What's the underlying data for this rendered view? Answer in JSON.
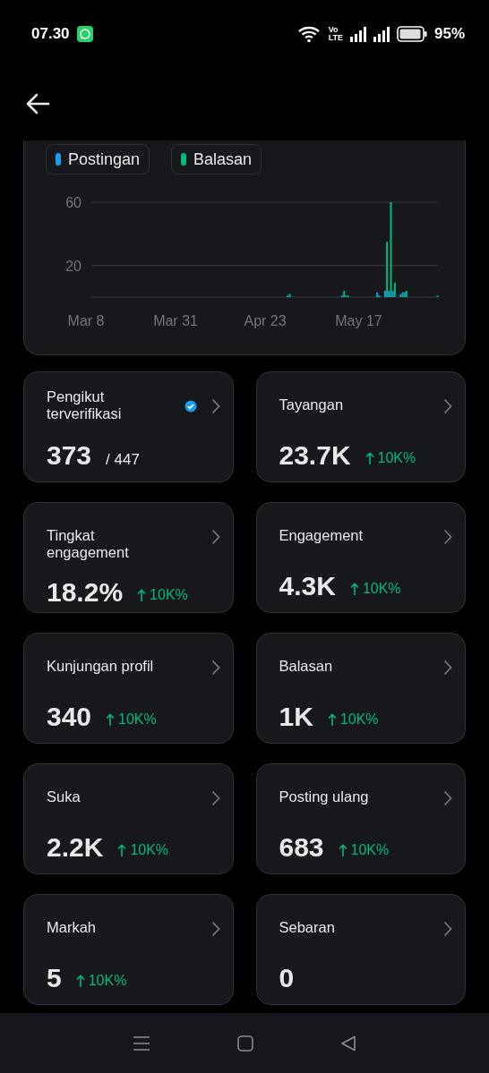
{
  "status_bar": {
    "time": "07.30",
    "network_label_top": "Vo",
    "network_label_bottom": "LTE",
    "battery": "95%"
  },
  "chart": {
    "chart_data": {
      "type": "bar",
      "categories": [
        "Mar 8",
        null,
        null,
        null,
        null,
        null,
        null,
        null,
        null,
        null,
        null,
        null,
        null,
        null,
        null,
        null,
        null,
        null,
        null,
        null,
        null,
        null,
        null,
        "Mar 31",
        null,
        null,
        null,
        null,
        null,
        null,
        null,
        null,
        null,
        null,
        null,
        null,
        null,
        null,
        null,
        null,
        null,
        null,
        null,
        null,
        null,
        null,
        "Apr 23",
        null,
        null,
        null,
        null,
        null,
        null,
        null,
        null,
        null,
        null,
        null,
        null,
        null,
        null,
        null,
        null,
        null,
        null,
        null,
        null,
        null,
        null,
        null,
        "May 17",
        null,
        null,
        null,
        null,
        null,
        null,
        null,
        null,
        null,
        null,
        null,
        null,
        null,
        null,
        null,
        null,
        null,
        null,
        null,
        null
      ],
      "series": [
        {
          "name": "Postingan",
          "color": "#1d9bf0",
          "values": [
            0,
            0,
            0,
            0,
            0,
            0,
            0,
            0,
            0,
            0,
            0,
            0,
            0,
            0,
            0,
            0,
            0,
            0,
            0,
            0,
            0,
            0,
            0,
            0,
            0,
            0,
            0,
            0,
            0,
            0,
            0,
            0,
            0,
            0,
            0,
            0,
            0,
            0,
            0,
            0,
            0,
            0,
            0,
            0,
            0,
            0,
            0,
            0,
            0,
            0,
            0,
            0,
            1,
            0,
            0,
            0,
            0,
            0,
            0,
            0,
            0,
            0,
            0,
            0,
            0,
            0,
            1,
            1,
            0,
            0,
            0,
            0,
            0,
            0,
            0,
            3,
            0,
            4,
            4,
            4,
            0,
            2,
            3,
            0,
            0,
            0,
            0,
            0,
            0,
            0,
            0
          ]
        },
        {
          "name": "Balasan",
          "color": "#00ba7c",
          "values": [
            0,
            0,
            0,
            0,
            0,
            0,
            0,
            0,
            0,
            0,
            0,
            0,
            0,
            0,
            0,
            0,
            0,
            0,
            0,
            0,
            0,
            0,
            0,
            0,
            0,
            0,
            0,
            0,
            0,
            0,
            0,
            0,
            0,
            0,
            0,
            0,
            0,
            0,
            0,
            0,
            0,
            0,
            0,
            0,
            0,
            0,
            0,
            0,
            0,
            0,
            0,
            0,
            2,
            0,
            0,
            0,
            0,
            0,
            0,
            0,
            0,
            0,
            0,
            0,
            0,
            0,
            4,
            1,
            0,
            0,
            0,
            0,
            0,
            0,
            0,
            1,
            0,
            35,
            60,
            9,
            0,
            3,
            4,
            0,
            0,
            0,
            0,
            0,
            0,
            0,
            1
          ]
        }
      ],
      "ylim": [
        0,
        60
      ],
      "yticks": [
        20,
        60
      ]
    }
  },
  "metrics": [
    {
      "title": "Pengikut terverifikasi",
      "value": "373",
      "total": "/ 447",
      "verified": true
    },
    {
      "title": "Tayangan",
      "value": "23.7K",
      "change": "10K%",
      "verified": false
    },
    {
      "title": "Tingkat engagement",
      "value": "18.2%",
      "change": "10K%",
      "verified": false
    },
    {
      "title": "Engagement",
      "value": "4.3K",
      "change": "10K%",
      "verified": false
    },
    {
      "title": "Kunjungan profil",
      "value": "340",
      "change": "10K%",
      "verified": false
    },
    {
      "title": "Balasan",
      "value": "1K",
      "change": "10K%",
      "verified": false
    },
    {
      "title": "Suka",
      "value": "2.2K",
      "change": "10K%",
      "verified": false
    },
    {
      "title": "Posting ulang",
      "value": "683",
      "change": "10K%",
      "verified": false
    },
    {
      "title": "Markah",
      "value": "5",
      "change": "10K%",
      "verified": false
    },
    {
      "title": "Sebaran",
      "value": "0",
      "verified": false
    }
  ]
}
